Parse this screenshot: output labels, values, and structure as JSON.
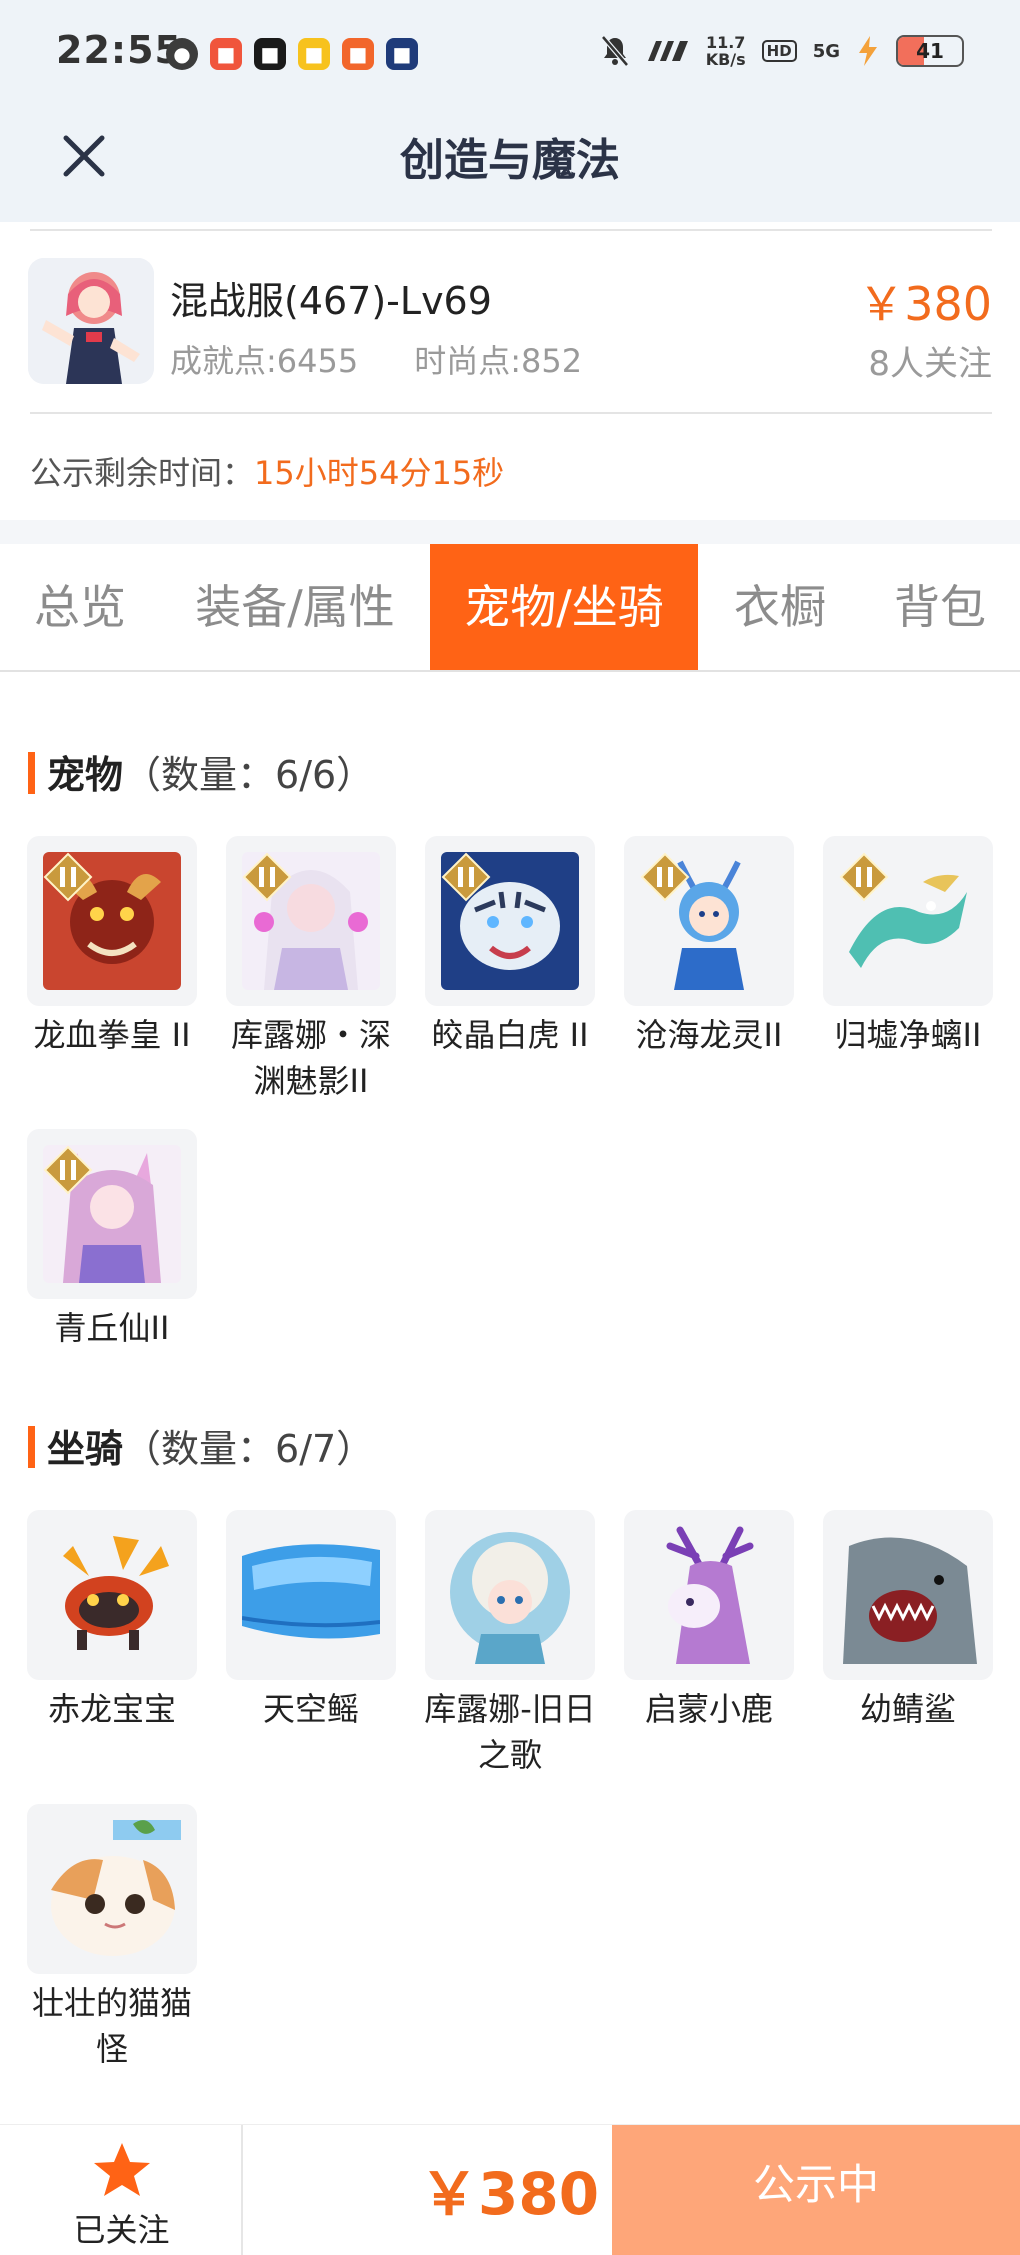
{
  "status_bar": {
    "time": "22:55",
    "speed": "11.7\nKB/s",
    "speed_value": "11.7",
    "speed_unit": "KB/s",
    "hd": "HD",
    "network": "5G",
    "battery": "41"
  },
  "header": {
    "title": "创造与魔法"
  },
  "listing": {
    "server": "混战服(467)-Lv69",
    "achievement": "成就点:6455",
    "fashion": "时尚点:852",
    "price": "￥380",
    "followers": "8人关注",
    "remain_label": "公示剩余时间：",
    "remain_value": "15小时54分15秒"
  },
  "tabs": [
    {
      "label": "总览",
      "active": false
    },
    {
      "label": "装备/属性",
      "active": false
    },
    {
      "label": "宠物/坐骑",
      "active": true
    },
    {
      "label": "衣橱",
      "active": false
    },
    {
      "label": "背包",
      "active": false
    }
  ],
  "pets": {
    "title": "宠物",
    "count": "（数量：6/6）",
    "items": [
      {
        "name": "龙血拳皇 II",
        "icon": "red-dragon-beast",
        "color": "#c9452f"
      },
      {
        "name": "库露娜・深渊魅影II",
        "icon": "white-hair-girl",
        "color": "#e9d8f2"
      },
      {
        "name": "皎晶白虎 II",
        "icon": "white-tiger",
        "color": "#6f8db8"
      },
      {
        "name": "沧海龙灵II",
        "icon": "blue-dragon-spirit",
        "color": "#5aa6e8"
      },
      {
        "name": "归墟净螭II",
        "icon": "teal-dragon",
        "color": "#4fbfb2"
      },
      {
        "name": "青丘仙II",
        "icon": "fox-fairy",
        "color": "#d9a8d8"
      }
    ]
  },
  "mounts": {
    "title": "坐骑",
    "count": "（数量：6/7）",
    "items": [
      {
        "name": "赤龙宝宝",
        "icon": "red-baby-dragon",
        "color": "#d2421f"
      },
      {
        "name": "天空鳐",
        "icon": "sky-ray",
        "color": "#3d9ee8"
      },
      {
        "name": "库露娜-旧日之歌",
        "icon": "fluffy-girl",
        "color": "#9fd0e6"
      },
      {
        "name": "启蒙小鹿",
        "icon": "little-deer",
        "color": "#b57ad1"
      },
      {
        "name": "幼鲭鲨",
        "icon": "baby-shark",
        "color": "#7b8a94"
      },
      {
        "name": "壮壮的猫猫怪",
        "icon": "cat-monster",
        "color": "#e8a05a"
      }
    ]
  },
  "bottom_bar": {
    "follow_label": "已关注",
    "price": "￥380",
    "status_button": "公示中"
  },
  "colors": {
    "accent": "#ff6315",
    "price": "#f26b1d",
    "status_button": "#fea679"
  }
}
